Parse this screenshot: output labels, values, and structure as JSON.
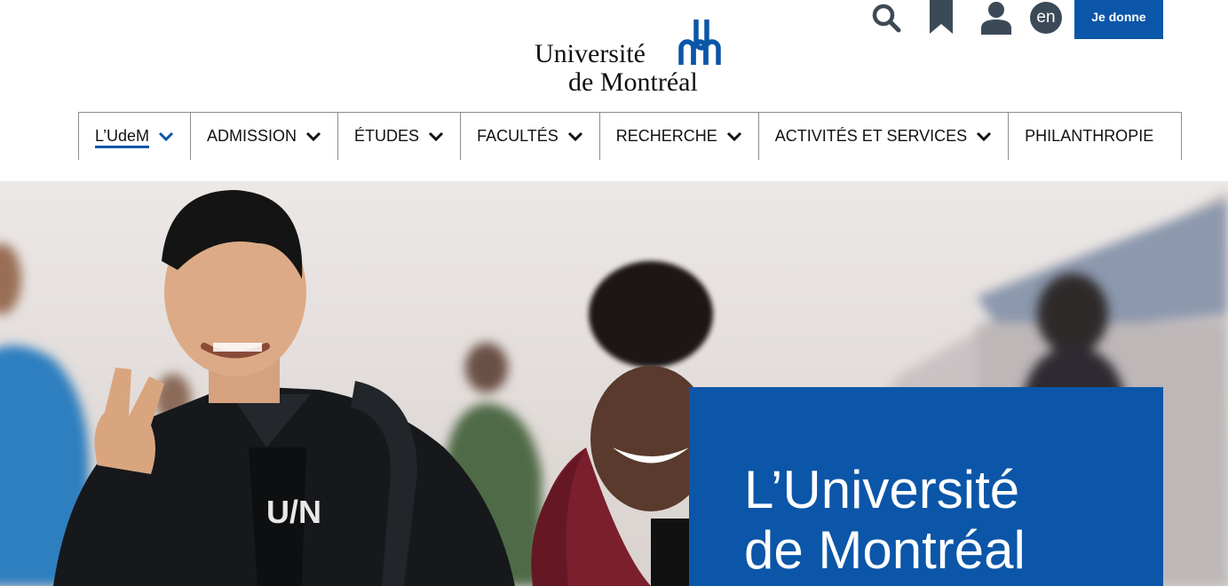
{
  "logo": {
    "line1": "Université",
    "line2": "de Montréal",
    "brand_color": "#0b56a8"
  },
  "utility": {
    "icons": [
      "search-icon",
      "bookmark-icon",
      "user-icon"
    ],
    "lang": "en",
    "donate": "Je donne",
    "donate_color": "#0b56a8",
    "icon_color": "#3c4a58"
  },
  "nav": {
    "items": [
      {
        "label": "L’UdeM",
        "dropdown": true,
        "active": true
      },
      {
        "label": "ADMISSION",
        "dropdown": true
      },
      {
        "label": "ÉTUDES",
        "dropdown": true
      },
      {
        "label": "FACULTÉS",
        "dropdown": true
      },
      {
        "label": "RECHERCHE",
        "dropdown": true
      },
      {
        "label": "ACTIVITÉS ET SERVICES",
        "dropdown": true
      },
      {
        "label": "PHILANTHROPIE",
        "dropdown": false
      }
    ]
  },
  "hero": {
    "title_line1": "L’Université",
    "title_line2": "de Montréal",
    "box_color": "#0b56a8",
    "shirt_print": "U/N"
  }
}
